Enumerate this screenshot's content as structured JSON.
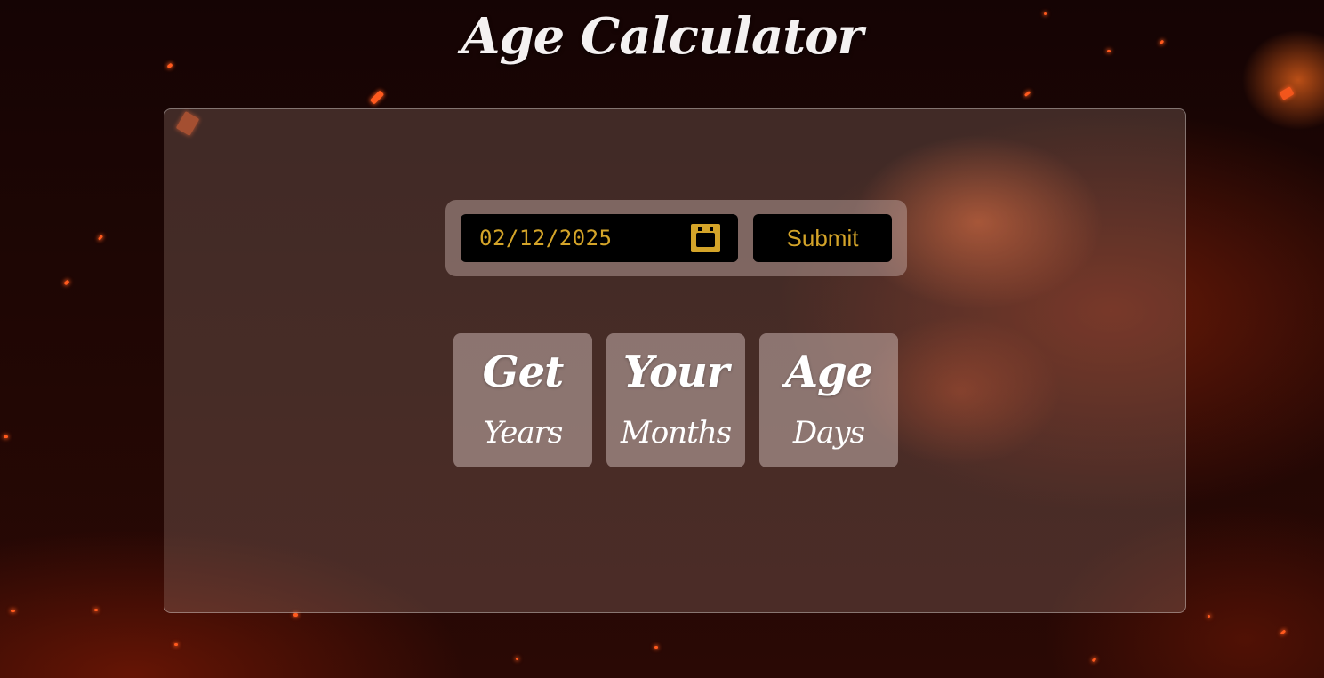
{
  "page": {
    "title": "Age Calculator",
    "accent_color": "#d4a429",
    "background": "fire-embers-dark"
  },
  "form": {
    "date_value": "02/12/2025",
    "calendar_icon": "calendar-icon",
    "submit_label": "Submit"
  },
  "results": [
    {
      "heading": "Get",
      "unit": "Years"
    },
    {
      "heading": "Your",
      "unit": "Months"
    },
    {
      "heading": "Age",
      "unit": "Days"
    }
  ]
}
